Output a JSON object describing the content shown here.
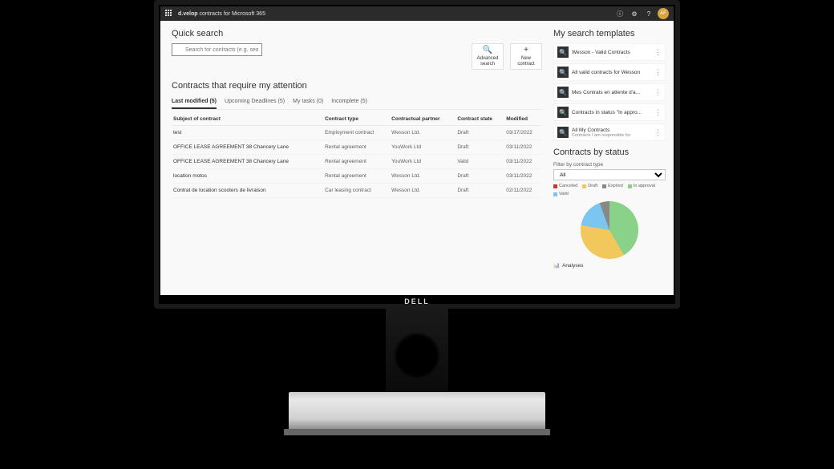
{
  "header": {
    "app_brand": "d.velop",
    "app_product": "contracts",
    "app_suffix": "for Microsoft 365",
    "icons": {
      "info": "ⓘ",
      "settings": "⚙",
      "help": "?",
      "avatar": "AF"
    }
  },
  "quick_search": {
    "title": "Quick search",
    "placeholder": "Search for contracts (e.g. search term, contractual partner or contract ID)"
  },
  "actions": {
    "advanced": {
      "icon": "🔍",
      "label": "Advanced search"
    },
    "new_contract": {
      "icon": "+",
      "label": "New contract"
    }
  },
  "attention": {
    "title": "Contracts that require my attention",
    "tabs": [
      {
        "label": "Last modified (5)",
        "active": true
      },
      {
        "label": "Upcoming Deadlines (5)",
        "active": false
      },
      {
        "label": "My tasks (0)",
        "active": false
      },
      {
        "label": "Incomplete (5)",
        "active": false
      }
    ],
    "columns": [
      "Subject of contract",
      "Contract type",
      "Contractual partner",
      "Contract state",
      "Modified"
    ],
    "rows": [
      {
        "subject": "test",
        "type": "Employment contract",
        "partner": "Wesson Ltd.",
        "state": "Draft",
        "modified": "03/17/2022"
      },
      {
        "subject": "OFFICE LEASE AGREEMENT 38 Chancery Lane",
        "type": "Rental agreement",
        "partner": "YouWork Ltd",
        "state": "Draft",
        "modified": "03/11/2022"
      },
      {
        "subject": "OFFICE LEASE AGREEMENT 38 Chancery Lane",
        "type": "Rental agreement",
        "partner": "YouWork Ltd",
        "state": "Valid",
        "modified": "03/11/2022"
      },
      {
        "subject": "location motos",
        "type": "Rental agreement",
        "partner": "Wesson Ltd.",
        "state": "Draft",
        "modified": "03/11/2022"
      },
      {
        "subject": "Contrat de location scooters de livraison",
        "type": "Car leasing contract",
        "partner": "Wesson Ltd.",
        "state": "Draft",
        "modified": "02/11/2022"
      }
    ]
  },
  "templates": {
    "title": "My search templates",
    "items": [
      {
        "title": "Wesson - Valid Contracts",
        "sub": ""
      },
      {
        "title": "All valid contracts for Wesson",
        "sub": ""
      },
      {
        "title": "Mes Contrats en attente d'a...",
        "sub": ""
      },
      {
        "title": "Contracts in status \"In appro...",
        "sub": ""
      },
      {
        "title": "All My Contracts",
        "sub": "Contracts I am responsible for"
      }
    ]
  },
  "status_panel": {
    "title": "Contracts by status",
    "filter_label": "Filter by contract type",
    "filter_value": "All",
    "legend": {
      "canceled": "Canceled",
      "draft": "Draft",
      "expired": "Expired",
      "approval": "In approval",
      "valid": "Valid"
    },
    "analyses_label": "Analyses"
  },
  "chart_data": {
    "type": "pie",
    "title": "Contracts by status",
    "series": [
      {
        "name": "In approval",
        "value": 42,
        "color": "#8ad18a"
      },
      {
        "name": "Draft",
        "value": 36,
        "color": "#f2c75c"
      },
      {
        "name": "Valid",
        "value": 17,
        "color": "#7bc6f0"
      },
      {
        "name": "Expired",
        "value": 5,
        "color": "#8a8886"
      }
    ]
  },
  "monitor_brand": "DELL"
}
